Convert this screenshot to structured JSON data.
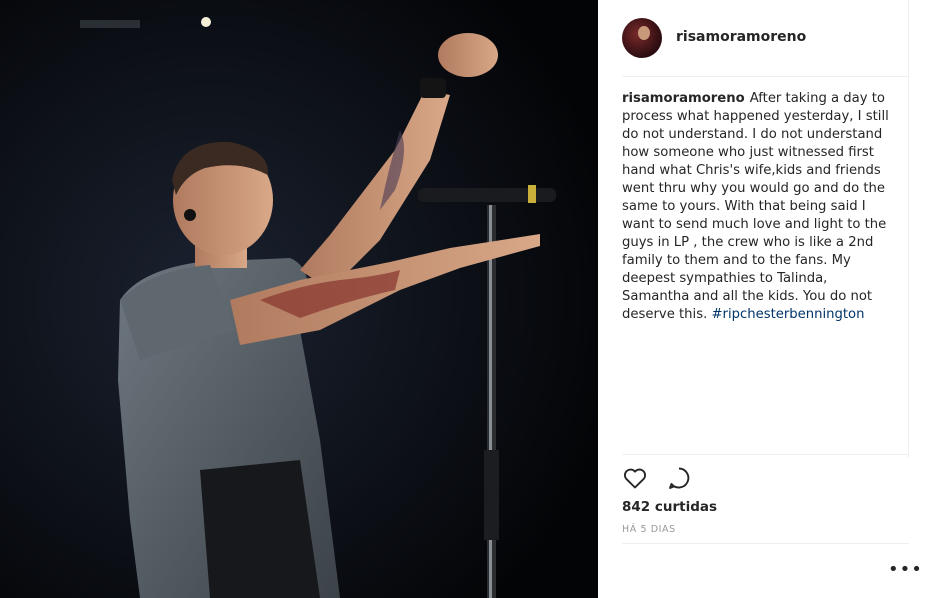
{
  "post": {
    "username": "risamoramoreno",
    "caption_text": "After taking a day to process what happened yesterday, I still do not understand. I do not understand how someone who just witnessed first hand what Chris's wife,kids and friends went thru why you would go and do the same to yours. With that being said I want to send much love and light to the guys in LP , the crew who is like a 2nd family to them and to the fans. My deepest sympathies to Talinda, Samantha and all the kids. You do not deserve this.",
    "hashtag": "#ripchesterbennington",
    "likes": "842 curtidas",
    "timestamp": "HÁ 5 DIAS",
    "more_label": "•••"
  },
  "icons": {
    "like": "heart-icon",
    "comment": "comment-icon"
  },
  "colors": {
    "text": "#262626",
    "hashtag": "#003569",
    "muted": "#999999",
    "photo_bg": "#05070b"
  }
}
